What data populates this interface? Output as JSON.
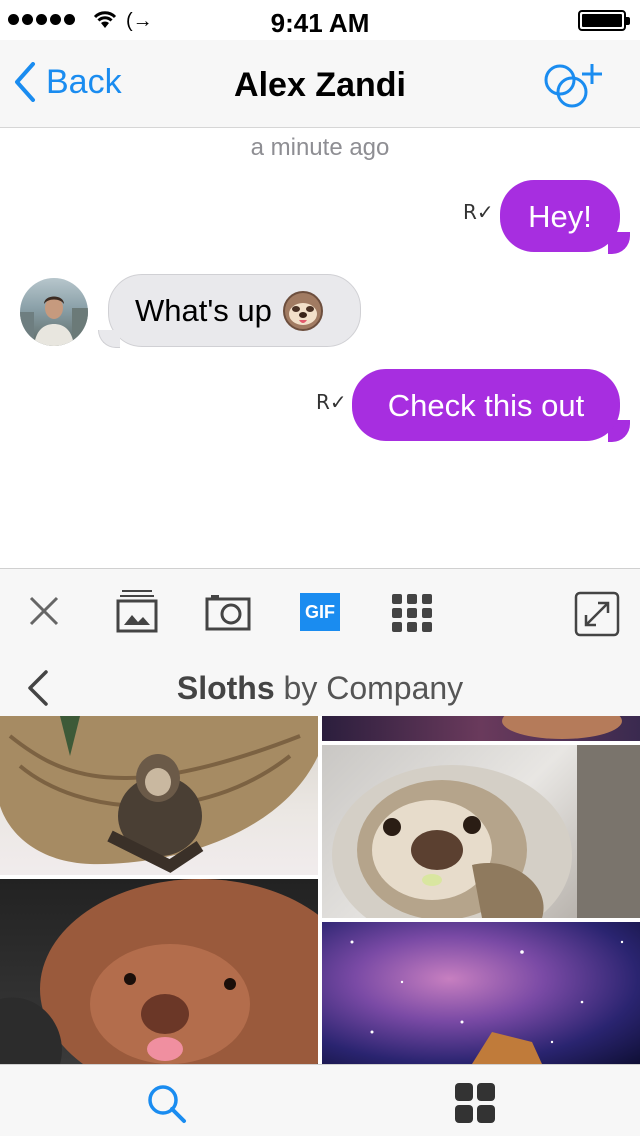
{
  "status_bar": {
    "time": "9:41 AM"
  },
  "nav": {
    "back_label": "Back",
    "title": "Alex Zandi"
  },
  "conversation": {
    "timestamp": "a minute ago",
    "messages": [
      {
        "direction": "out",
        "text": "Hey!",
        "receipt": "R"
      },
      {
        "direction": "in",
        "text": "What's up"
      },
      {
        "direction": "out",
        "text": "Check this out",
        "receipt": "R"
      }
    ]
  },
  "toolbar": {
    "gif_label": "GIF"
  },
  "gif_panel": {
    "collection": "Sloths",
    "by_text": "by Company"
  },
  "colors": {
    "accent": "#1a8cf0",
    "outgoing_bubble": "#a72ee0",
    "incoming_bubble": "#e9e9ec"
  }
}
